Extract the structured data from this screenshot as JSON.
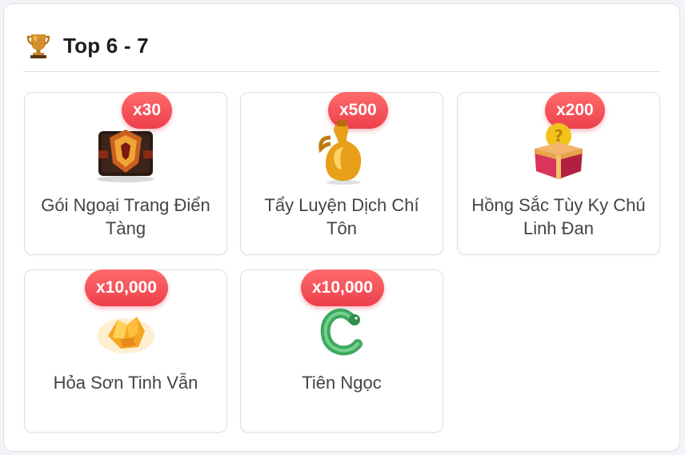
{
  "header": {
    "title": "Top 6 - 7",
    "icon": "trophy-icon"
  },
  "colors": {
    "badge": "#ec3f4c",
    "border": "#dcdfe6",
    "title": "#1d1d1f"
  },
  "items": [
    {
      "name": "Gói Ngoại Trang Điển Tàng",
      "qty": "x30",
      "icon": "costume-chest-icon"
    },
    {
      "name": "Tẩy Luyện Dịch Chí Tôn",
      "qty": "x500",
      "icon": "elixir-gourd-icon"
    },
    {
      "name": "Hồng Sắc Tùy Ky Chú Linh Đan",
      "qty": "x200",
      "icon": "mystery-box-icon"
    },
    {
      "name": "Hỏa Sơn Tinh Vẫn",
      "qty": "x10,000",
      "icon": "fire-crystal-icon"
    },
    {
      "name": "Tiên Ngọc",
      "qty": "x10,000",
      "icon": "jade-dragon-icon"
    }
  ]
}
